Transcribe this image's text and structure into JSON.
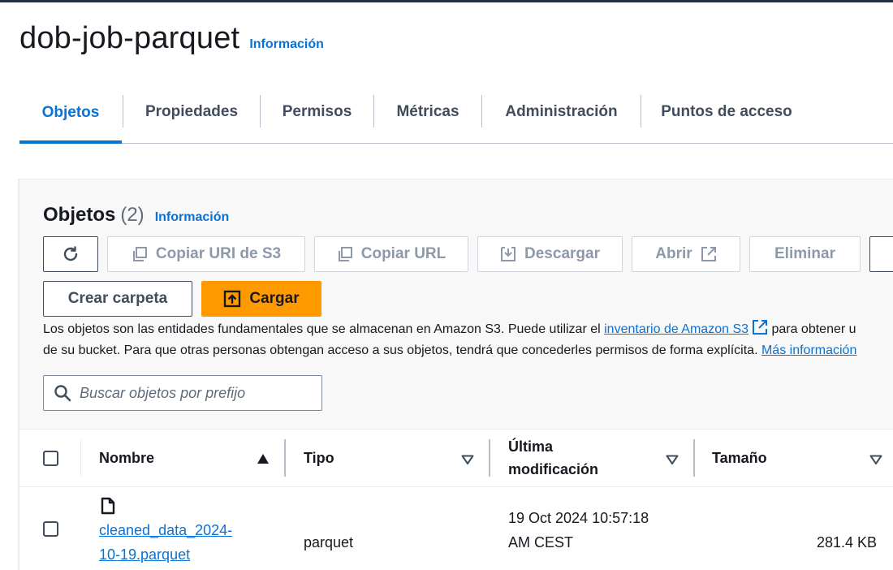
{
  "header": {
    "title": "dob-job-parquet",
    "info_label": "Información"
  },
  "tabs": [
    {
      "label": "Objetos",
      "active": true
    },
    {
      "label": "Propiedades"
    },
    {
      "label": "Permisos"
    },
    {
      "label": "Métricas"
    },
    {
      "label": "Administración"
    },
    {
      "label": "Puntos de acceso"
    }
  ],
  "objects_panel": {
    "title": "Objetos",
    "count": "(2)",
    "info_label": "Información",
    "toolbar": {
      "copy_s3_uri": "Copiar URI de S3",
      "copy_url": "Copiar URL",
      "download": "Descargar",
      "open": "Abrir",
      "delete": "Eliminar",
      "create_folder": "Crear carpeta",
      "upload": "Cargar"
    },
    "description": {
      "text1": "Los objetos son las entidades fundamentales que se almacenan en Amazon S3. Puede utilizar el ",
      "inventory_link": "inventario de Amazon S3",
      "text2": " para obtener u",
      "text3": "de su bucket. Para que otras personas obtengan acceso a sus objetos, tendrá que concederles permisos de forma explícita. ",
      "more_link": "Más información"
    },
    "search": {
      "placeholder": "Buscar objetos por prefijo"
    },
    "table": {
      "columns": {
        "name": "Nombre",
        "type": "Tipo",
        "modified_line1": "Última",
        "modified_line2": "modificación",
        "size": "Tamaño"
      },
      "rows": [
        {
          "name_line1": "cleaned_data_2024-",
          "name_line2": "10-19.parquet",
          "type": "parquet",
          "modified_line1": "19 Oct 2024 10:57:18",
          "modified_line2": "AM CEST",
          "size": "281.4 KB"
        }
      ]
    }
  },
  "colors": {
    "link": "#0972d3",
    "primary_button": "#ff9900",
    "text": "#16191f"
  }
}
